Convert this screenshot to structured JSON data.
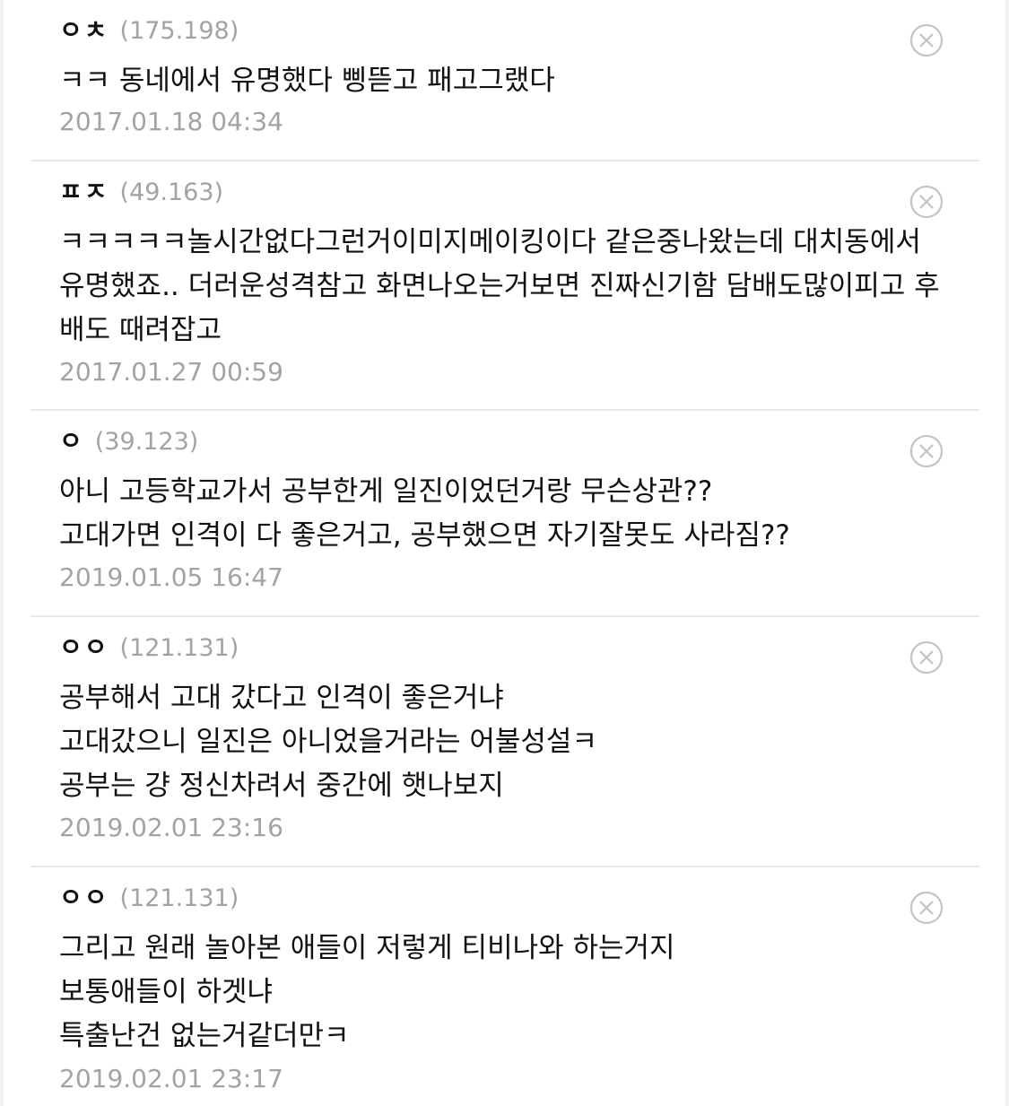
{
  "comments": [
    {
      "author": "ㅇㅊ",
      "ip": "(175.198)",
      "lines": [
        "ㅋㅋ 동네에서 유명했다 삥뜯고 패고그랬다"
      ],
      "date": "2017.01.18 04:34"
    },
    {
      "author": "ㅍㅈ",
      "ip": "(49.163)",
      "lines": [
        "ㅋㅋㅋㅋㅋ놀시간없다그런거이미지메이킹이다 같은중나왔는데 대치동에서",
        "유명했죠.. 더러운성격참고 화면나오는거보면 진짜신기함 담배도많이피고 후",
        "배도 때려잡고"
      ],
      "date": "2017.01.27 00:59"
    },
    {
      "author": "ㅇ",
      "ip": "(39.123)",
      "lines": [
        "아니 고등학교가서 공부한게 일진이었던거랑 무슨상관??",
        "고대가면 인격이 다 좋은거고, 공부했으면 자기잘못도 사라짐??"
      ],
      "date": "2019.01.05 16:47"
    },
    {
      "author": "ㅇㅇ",
      "ip": "(121.131)",
      "lines": [
        "공부해서 고대 갔다고 인격이 좋은거냐",
        "고대갔으니 일진은 아니었을거라는 어불성설ㅋ",
        "공부는 걍 정신차려서 중간에 햇나보지"
      ],
      "date": "2019.02.01 23:16"
    },
    {
      "author": "ㅇㅇ",
      "ip": "(121.131)",
      "lines": [
        "그리고 원래 놀아본 애들이 저렇게 티비나와 하는거지",
        "보통애들이 하겟냐",
        "특출난건 없는거같더만ㅋ"
      ],
      "date": "2019.02.01 23:17"
    }
  ],
  "icons": {
    "delete": "close-circle-icon"
  },
  "colors": {
    "text": "#111111",
    "meta": "#a3a3a3",
    "divider": "#e9e9e9",
    "icon": "#c4c4c4"
  }
}
